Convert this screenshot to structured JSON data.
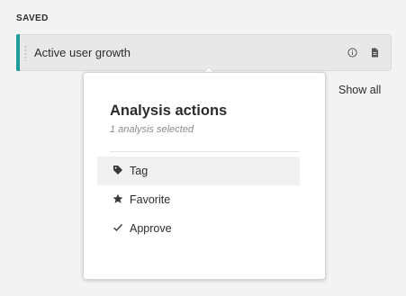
{
  "section": {
    "label": "SAVED"
  },
  "saved_item": {
    "title": "Active user growth",
    "accent_color": "#1e9c99",
    "icons": [
      "info-icon",
      "report-icon"
    ]
  },
  "show_all": {
    "label": "Show all"
  },
  "popover": {
    "title": "Analysis actions",
    "subtitle": "1 analysis selected",
    "actions": [
      {
        "label": "Tag",
        "icon": "tag-icon",
        "hovered": true
      },
      {
        "label": "Favorite",
        "icon": "star-icon",
        "hovered": false
      },
      {
        "label": "Approve",
        "icon": "checkmark-icon",
        "hovered": false
      }
    ]
  }
}
